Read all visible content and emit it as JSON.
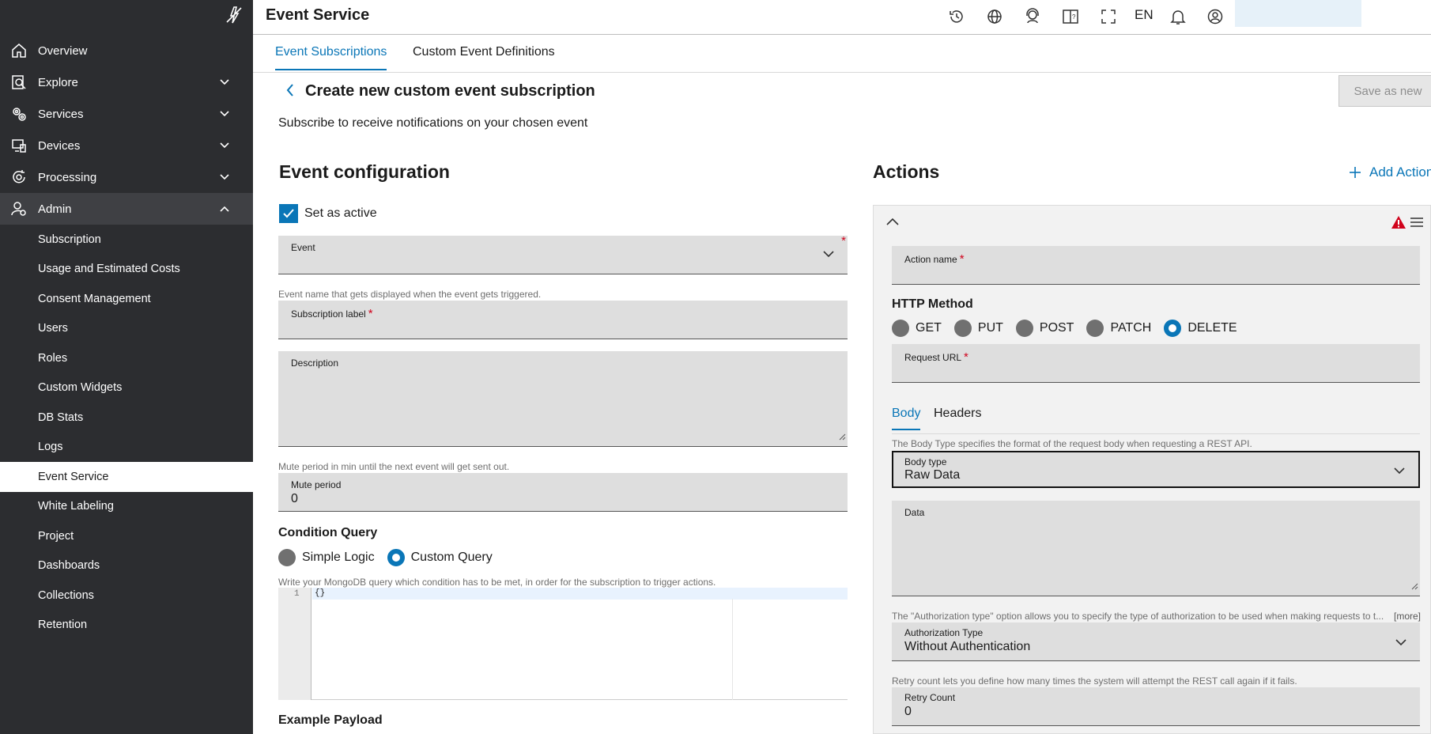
{
  "app": {
    "title": "Event Service"
  },
  "header": {
    "language": "EN"
  },
  "sidebar": {
    "items": [
      {
        "label": "Overview"
      },
      {
        "label": "Explore"
      },
      {
        "label": "Services"
      },
      {
        "label": "Devices"
      },
      {
        "label": "Processing"
      },
      {
        "label": "Admin"
      }
    ],
    "admin_items": [
      "Subscription",
      "Usage and Estimated Costs",
      "Consent Management",
      "Users",
      "Roles",
      "Custom Widgets",
      "DB Stats",
      "Logs",
      "Event Service",
      "White Labeling",
      "Project",
      "Dashboards",
      "Collections",
      "Retention"
    ]
  },
  "tabs": [
    "Event Subscriptions",
    "Custom Event Definitions"
  ],
  "page": {
    "title": "Create new custom event subscription",
    "subtitle": "Subscribe to receive notifications on your chosen event",
    "save_label": "Save as new"
  },
  "event_config": {
    "heading": "Event configuration",
    "set_active_label": "Set as active",
    "event_label": "Event",
    "event_helper": "Event name that gets displayed when the event gets triggered.",
    "subscription_label": "Subscription label",
    "description_label": "Description",
    "mute_helper": "Mute period in min until the next event will get sent out.",
    "mute_label": "Mute period",
    "mute_value": "0",
    "condition_heading": "Condition Query",
    "condition_options": [
      "Simple Logic",
      "Custom Query"
    ],
    "query_helper": "Write your MongoDB query which condition has to be met, in order for the subscription to trigger actions.",
    "line_number": "1",
    "query_code": "{}",
    "example_heading": "Example Payload"
  },
  "actions": {
    "heading": "Actions",
    "add_label": "Add Action",
    "action_name_label": "Action name",
    "http_heading": "HTTP Method",
    "http_methods": [
      "GET",
      "PUT",
      "POST",
      "PATCH",
      "DELETE"
    ],
    "request_url_label": "Request URL",
    "body_tabs": [
      "Body",
      "Headers"
    ],
    "body_helper": "The Body Type specifies the format of the request body when requesting a REST API.",
    "body_type_label": "Body type",
    "body_type_value": "Raw Data",
    "data_label": "Data",
    "auth_helper": "The \"Authorization type\" option allows you to specify the type of authorization to be used when making requests to t...",
    "more_label": "[more]",
    "auth_label": "Authorization Type",
    "auth_value": "Without Authentication",
    "retry_helper": "Retry count lets you define how many times the system will attempt the REST call again if it fails.",
    "retry_label": "Retry Count",
    "retry_value": "0"
  },
  "colors": {
    "accent": "#0a76b7",
    "sidebar": "#2c2d30",
    "field_bg": "#dedede",
    "required": "#d0021b",
    "warning": "#d0021b"
  }
}
